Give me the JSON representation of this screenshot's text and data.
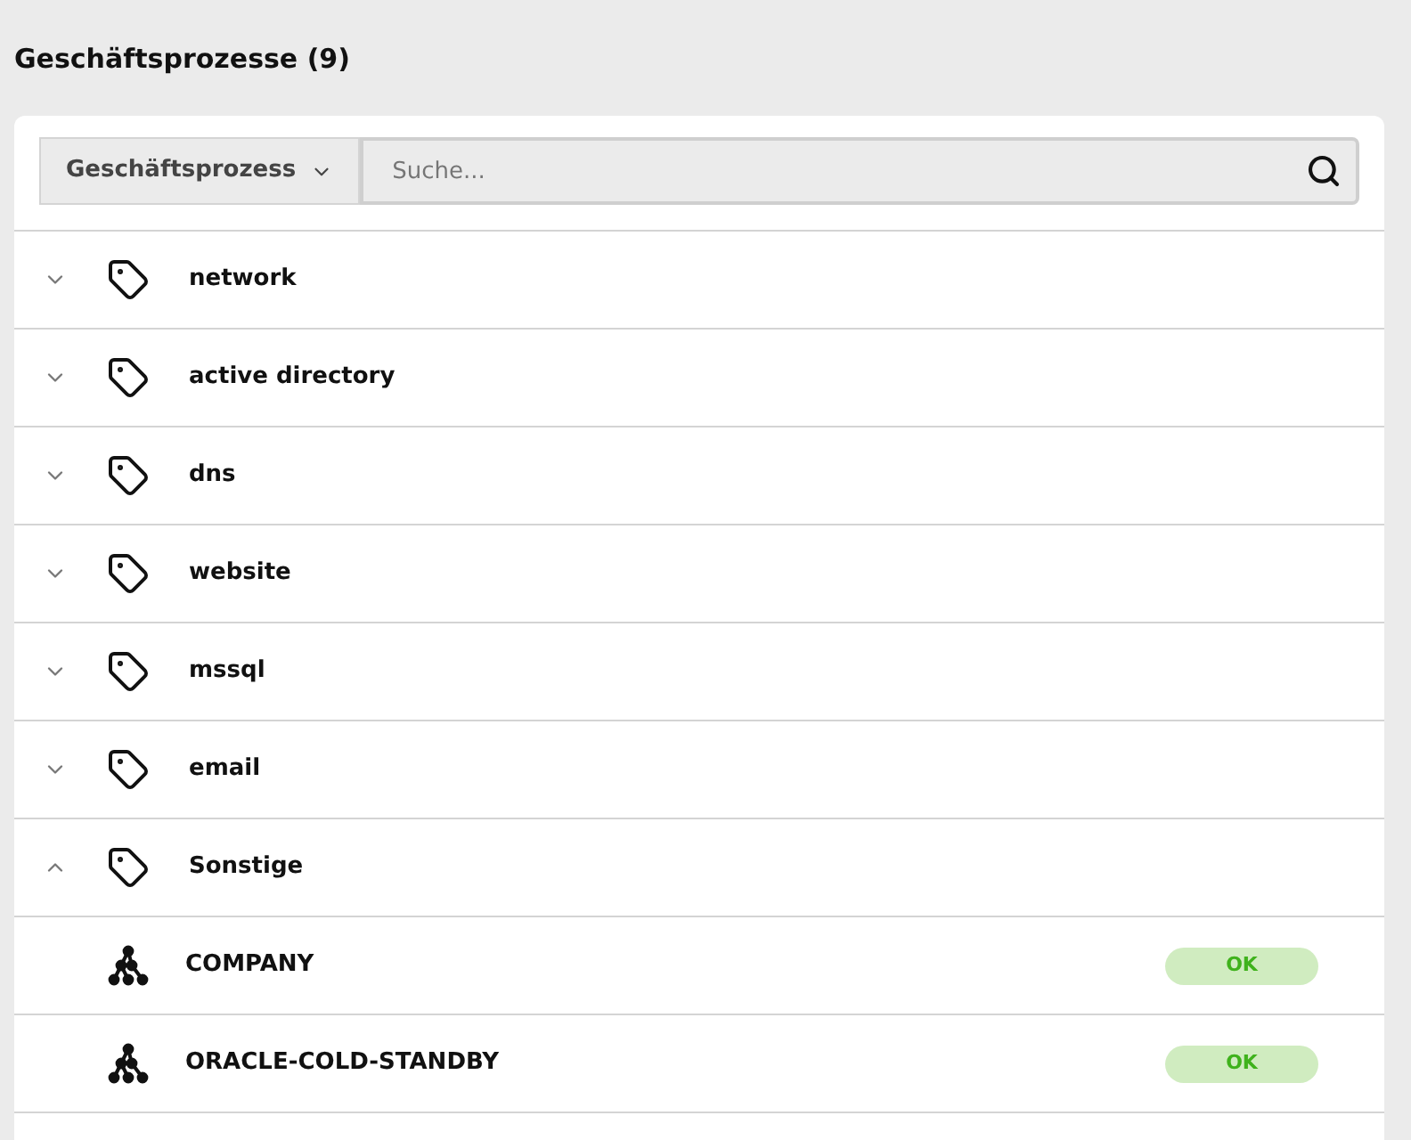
{
  "title": "Geschäftsprozesse (9)",
  "filter": {
    "dropdown": "Geschäftsprozess",
    "search": {
      "placeholder": "Suche..."
    }
  },
  "groups": [
    {
      "name": "network",
      "expanded": false
    },
    {
      "name": "active directory",
      "expanded": false
    },
    {
      "name": "dns",
      "expanded": false
    },
    {
      "name": "website",
      "expanded": false
    },
    {
      "name": "mssql",
      "expanded": false
    },
    {
      "name": "email",
      "expanded": false
    },
    {
      "name": "Sonstige",
      "expanded": true,
      "children": [
        {
          "name": "COMPANY",
          "status": "OK"
        },
        {
          "name": "ORACLE-COLD-STANDBY",
          "status": "OK"
        }
      ]
    }
  ]
}
